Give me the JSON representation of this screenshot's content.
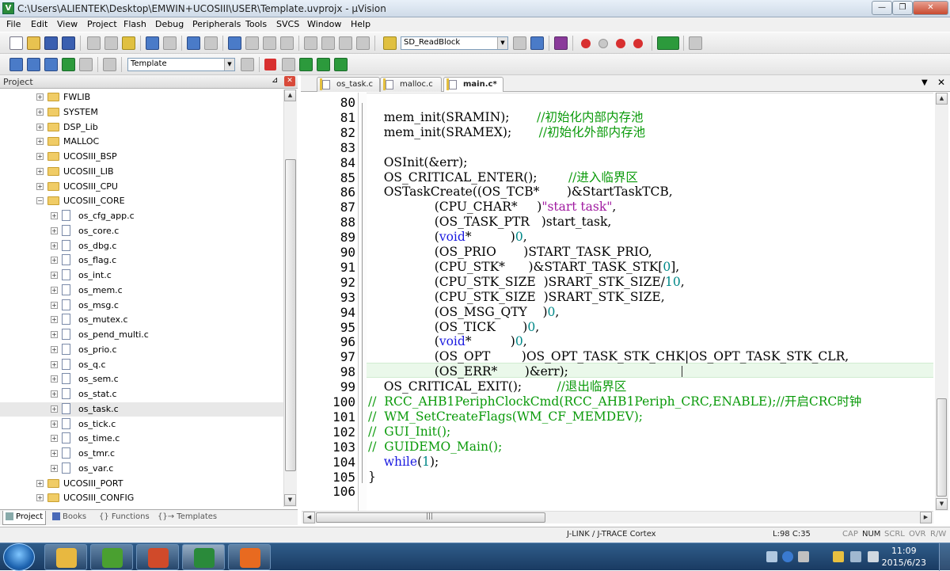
{
  "window": {
    "title": "C:\\Users\\ALIENTEK\\Desktop\\EMWIN+UCOSIII\\USER\\Template.uvprojx - µVision"
  },
  "menu": [
    "File",
    "Edit",
    "View",
    "Project",
    "Flash",
    "Debug",
    "Peripherals",
    "Tools",
    "SVCS",
    "Window",
    "Help"
  ],
  "toolbar": {
    "find_combo": "SD_ReadBlock",
    "target_combo": "Template"
  },
  "project_panel": {
    "title": "Project",
    "tree": [
      {
        "label": "FWLIB",
        "kind": "folder",
        "level": 0,
        "expander": "+"
      },
      {
        "label": "SYSTEM",
        "kind": "folder",
        "level": 0,
        "expander": "+"
      },
      {
        "label": "DSP_Lib",
        "kind": "folder",
        "level": 0,
        "expander": "+"
      },
      {
        "label": "MALLOC",
        "kind": "folder",
        "level": 0,
        "expander": "+"
      },
      {
        "label": "UCOSIII_BSP",
        "kind": "folder",
        "level": 0,
        "expander": "+"
      },
      {
        "label": "UCOSIII_LIB",
        "kind": "folder",
        "level": 0,
        "expander": "+"
      },
      {
        "label": "UCOSIII_CPU",
        "kind": "folder",
        "level": 0,
        "expander": "+"
      },
      {
        "label": "UCOSIII_CORE",
        "kind": "folder",
        "level": 0,
        "expander": "−"
      },
      {
        "label": "os_cfg_app.c",
        "kind": "file",
        "level": 1,
        "expander": "+"
      },
      {
        "label": "os_core.c",
        "kind": "file",
        "level": 1,
        "expander": "+"
      },
      {
        "label": "os_dbg.c",
        "kind": "file",
        "level": 1,
        "expander": "+"
      },
      {
        "label": "os_flag.c",
        "kind": "file",
        "level": 1,
        "expander": "+"
      },
      {
        "label": "os_int.c",
        "kind": "file",
        "level": 1,
        "expander": "+"
      },
      {
        "label": "os_mem.c",
        "kind": "file",
        "level": 1,
        "expander": "+"
      },
      {
        "label": "os_msg.c",
        "kind": "file",
        "level": 1,
        "expander": "+"
      },
      {
        "label": "os_mutex.c",
        "kind": "file",
        "level": 1,
        "expander": "+"
      },
      {
        "label": "os_pend_multi.c",
        "kind": "file",
        "level": 1,
        "expander": "+"
      },
      {
        "label": "os_prio.c",
        "kind": "file",
        "level": 1,
        "expander": "+"
      },
      {
        "label": "os_q.c",
        "kind": "file",
        "level": 1,
        "expander": "+"
      },
      {
        "label": "os_sem.c",
        "kind": "file",
        "level": 1,
        "expander": "+"
      },
      {
        "label": "os_stat.c",
        "kind": "file",
        "level": 1,
        "expander": "+"
      },
      {
        "label": "os_task.c",
        "kind": "file",
        "level": 1,
        "expander": "+",
        "selected": true
      },
      {
        "label": "os_tick.c",
        "kind": "file",
        "level": 1,
        "expander": "+"
      },
      {
        "label": "os_time.c",
        "kind": "file",
        "level": 1,
        "expander": "+"
      },
      {
        "label": "os_tmr.c",
        "kind": "file",
        "level": 1,
        "expander": "+"
      },
      {
        "label": "os_var.c",
        "kind": "file",
        "level": 1,
        "expander": "+"
      },
      {
        "label": "UCOSIII_PORT",
        "kind": "folder",
        "level": 0,
        "expander": "+"
      },
      {
        "label": "UCOSIII_CONFIG",
        "kind": "folder",
        "level": 0,
        "expander": "+"
      }
    ],
    "bottom_tabs": [
      {
        "label": "Project",
        "active": true
      },
      {
        "label": "Books",
        "active": false
      },
      {
        "label": "{} Functions",
        "active": false
      },
      {
        "label": "{}→ Templates",
        "active": false
      }
    ]
  },
  "editor": {
    "tabs": [
      {
        "label": "os_task.c",
        "active": false
      },
      {
        "label": "malloc.c",
        "active": false
      },
      {
        "label": "main.c*",
        "active": true
      }
    ],
    "lines": [
      {
        "n": "80",
        "segs": []
      },
      {
        "n": "81",
        "segs": [
          {
            "t": "    mem_init(SRAMIN);       ",
            "c": ""
          },
          {
            "t": "//初始化内部内存池",
            "c": "cm"
          }
        ]
      },
      {
        "n": "82",
        "segs": [
          {
            "t": "    mem_init(SRAMEX);       ",
            "c": ""
          },
          {
            "t": "//初始化外部内存池",
            "c": "cm"
          }
        ]
      },
      {
        "n": "83",
        "segs": []
      },
      {
        "n": "84",
        "segs": [
          {
            "t": "    OSInit(&err);",
            "c": ""
          }
        ]
      },
      {
        "n": "85",
        "segs": [
          {
            "t": "    OS_CRITICAL_ENTER();        ",
            "c": ""
          },
          {
            "t": "//进入临界区",
            "c": "cm"
          }
        ]
      },
      {
        "n": "86",
        "segs": [
          {
            "t": "    OSTaskCreate((OS_TCB*       )&StartTaskTCB,",
            "c": ""
          }
        ]
      },
      {
        "n": "87",
        "segs": [
          {
            "t": "                 (CPU_CHAR*     )",
            "c": ""
          },
          {
            "t": "\"start task\"",
            "c": "st"
          },
          {
            "t": ",",
            "c": ""
          }
        ]
      },
      {
        "n": "88",
        "segs": [
          {
            "t": "                 (OS_TASK_PTR   )start_task,",
            "c": ""
          }
        ]
      },
      {
        "n": "89",
        "segs": [
          {
            "t": "                 (",
            "c": ""
          },
          {
            "t": "void",
            "c": "kw"
          },
          {
            "t": "*          )",
            "c": ""
          },
          {
            "t": "0",
            "c": "nm"
          },
          {
            "t": ",",
            "c": ""
          }
        ]
      },
      {
        "n": "90",
        "segs": [
          {
            "t": "                 (OS_PRIO       )START_TASK_PRIO,",
            "c": ""
          }
        ]
      },
      {
        "n": "91",
        "segs": [
          {
            "t": "                 (CPU_STK*      )&START_TASK_STK[",
            "c": ""
          },
          {
            "t": "0",
            "c": "nm"
          },
          {
            "t": "],",
            "c": ""
          }
        ]
      },
      {
        "n": "92",
        "segs": [
          {
            "t": "                 (CPU_STK_SIZE  )SRART_STK_SIZE/",
            "c": ""
          },
          {
            "t": "10",
            "c": "nm"
          },
          {
            "t": ",",
            "c": ""
          }
        ]
      },
      {
        "n": "93",
        "segs": [
          {
            "t": "                 (CPU_STK_SIZE  )SRART_STK_SIZE,",
            "c": ""
          }
        ]
      },
      {
        "n": "94",
        "segs": [
          {
            "t": "                 (OS_MSG_QTY    )",
            "c": ""
          },
          {
            "t": "0",
            "c": "nm"
          },
          {
            "t": ",",
            "c": ""
          }
        ]
      },
      {
        "n": "95",
        "segs": [
          {
            "t": "                 (OS_TICK       )",
            "c": ""
          },
          {
            "t": "0",
            "c": "nm"
          },
          {
            "t": ",",
            "c": ""
          }
        ]
      },
      {
        "n": "96",
        "segs": [
          {
            "t": "                 (",
            "c": ""
          },
          {
            "t": "void",
            "c": "kw"
          },
          {
            "t": "*          )",
            "c": ""
          },
          {
            "t": "0",
            "c": "nm"
          },
          {
            "t": ",",
            "c": ""
          }
        ]
      },
      {
        "n": "97",
        "segs": [
          {
            "t": "                 (OS_OPT        )OS_OPT_TASK_STK_CHK|OS_OPT_TASK_STK_CLR,",
            "c": ""
          }
        ]
      },
      {
        "n": "98",
        "segs": [
          {
            "t": "                 (OS_ERR*       )&err);",
            "c": ""
          }
        ]
      },
      {
        "n": "99",
        "segs": [
          {
            "t": "    OS_CRITICAL_EXIT();         ",
            "c": ""
          },
          {
            "t": "//退出临界区",
            "c": "cm"
          }
        ]
      },
      {
        "n": "100",
        "segs": [
          {
            "t": "//  RCC_AHB1PeriphClockCmd(RCC_AHB1Periph_CRC,ENABLE);//开启CRC时钟",
            "c": "cm"
          }
        ]
      },
      {
        "n": "101",
        "segs": [
          {
            "t": "//  WM_SetCreateFlags(WM_CF_MEMDEV);",
            "c": "cm"
          }
        ]
      },
      {
        "n": "102",
        "segs": [
          {
            "t": "//  GUI_Init();",
            "c": "cm"
          }
        ]
      },
      {
        "n": "103",
        "segs": [
          {
            "t": "//  GUIDEMO_Main();",
            "c": "cm"
          }
        ]
      },
      {
        "n": "104",
        "segs": [
          {
            "t": "    ",
            "c": ""
          },
          {
            "t": "while",
            "c": "kw"
          },
          {
            "t": "(",
            "c": ""
          },
          {
            "t": "1",
            "c": "nm"
          },
          {
            "t": ");",
            "c": ""
          }
        ]
      },
      {
        "n": "105",
        "segs": [
          {
            "t": "}",
            "c": ""
          }
        ]
      },
      {
        "n": "106",
        "segs": []
      }
    ]
  },
  "statusbar": {
    "debugger": "J-LINK / J-TRACE Cortex",
    "position": "L:98 C:35",
    "indicators": [
      {
        "label": "CAP",
        "on": false
      },
      {
        "label": "NUM",
        "on": true
      },
      {
        "label": "SCRL",
        "on": false
      },
      {
        "label": "OVR",
        "on": false
      },
      {
        "label": "R/W",
        "on": false
      }
    ]
  },
  "taskbar": {
    "apps": [
      {
        "icon": "file-explorer-icon",
        "color": "#e8b840"
      },
      {
        "icon": "qt-creator-icon",
        "color": "#4aa030"
      },
      {
        "icon": "powerpoint-icon",
        "color": "#d04a2a"
      },
      {
        "icon": "keil-uvision-icon",
        "color": "#2a8a3a"
      },
      {
        "icon": "pdf-reader-icon",
        "color": "#e86a20"
      }
    ],
    "time": "11:09",
    "date": "2015/6/23"
  }
}
